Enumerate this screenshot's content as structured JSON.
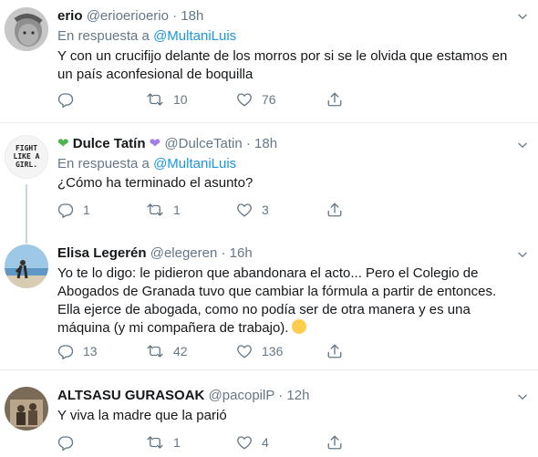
{
  "tweets": [
    {
      "name": "erio",
      "handle": "@erioerioerio",
      "dot": "·",
      "time": "18h",
      "reply_prefix": "En respuesta a",
      "reply_to": "@MultaniLuis",
      "text_lines": [
        "Y con un crucifijo delante de los morros por si se le olvida que estamos en",
        "un país aconfesional de boquilla"
      ],
      "replies": "",
      "retweets": "10",
      "likes": "76"
    },
    {
      "name": "Dulce Tatín",
      "handle": "@DulceTatin",
      "dot": "·",
      "time": "18h",
      "reply_prefix": "En respuesta a",
      "reply_to": "@MultaniLuis",
      "avatar_text": [
        "FIGHT",
        "LIKE A",
        "GIRL."
      ],
      "text_lines": [
        "¿Cómo ha terminado el asunto?"
      ],
      "replies": "1",
      "retweets": "1",
      "likes": "3"
    },
    {
      "name": "Elisa Legerén",
      "handle": "@elegeren",
      "dot": "·",
      "time": "16h",
      "text_lines": [
        "Yo te lo digo: le pidieron que abandonara el acto... Pero el Colegio de",
        "Abogados de Granada tuvo que cambiar la fórmula a partir de entonces.",
        "Ella ejerce de abogada, como no podía ser de otra manera y es una",
        "máquina (y mi compañera de trabajo)."
      ],
      "replies": "13",
      "retweets": "42",
      "likes": "136"
    },
    {
      "name": "ALTSASU GURASOAK",
      "handle": "@pacopilP",
      "dot": "·",
      "time": "12h",
      "text_lines": [
        "Y viva la madre que la parió"
      ],
      "replies": "",
      "retweets": "1",
      "likes": "4"
    }
  ],
  "colors": {
    "text": "#14171a",
    "secondary": "#657786",
    "link": "#1b95e0",
    "separator": "#e6ecf0",
    "thread_line": "#ccd6dd"
  }
}
